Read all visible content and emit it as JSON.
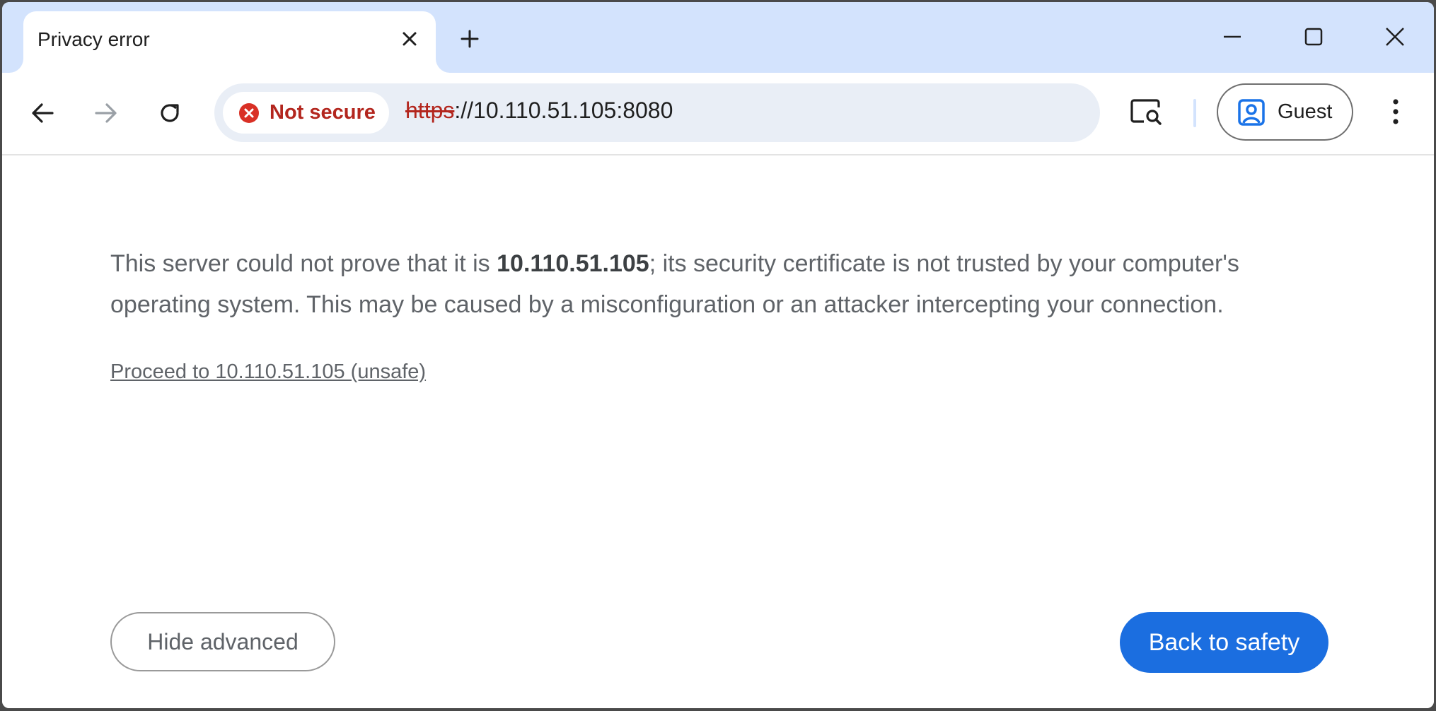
{
  "window": {
    "tab": {
      "title": "Privacy error",
      "close_icon": "close-icon"
    },
    "new_tab_icon": "plus-icon",
    "controls": [
      "minimize-icon",
      "maximize-icon",
      "close-icon"
    ]
  },
  "toolbar": {
    "back_icon": "arrow-left-icon",
    "forward_icon": "arrow-right-icon",
    "reload_icon": "reload-icon",
    "security_chip": {
      "icon": "error-x-icon",
      "label": "Not secure",
      "color": "#b3261e"
    },
    "url": {
      "scheme": "https",
      "rest": "://10.110.51.105:8080"
    },
    "lens_icon": "screen-search-icon",
    "profile": {
      "icon": "profile-icon",
      "label": "Guest"
    },
    "menu_icon": "three-dots-vertical-icon"
  },
  "page": {
    "details": {
      "before": "This server could not prove that it is ",
      "host": "10.110.51.105",
      "after": "; its security certificate is not trusted by your computer's operating system. This may be caused by a misconfiguration or an attacker intercepting your connection."
    },
    "proceed_link": "Proceed to 10.110.51.105 (unsafe)",
    "hide_advanced_button": "Hide advanced",
    "back_button": "Back to safety",
    "accent_color": "#1b6ee0"
  }
}
